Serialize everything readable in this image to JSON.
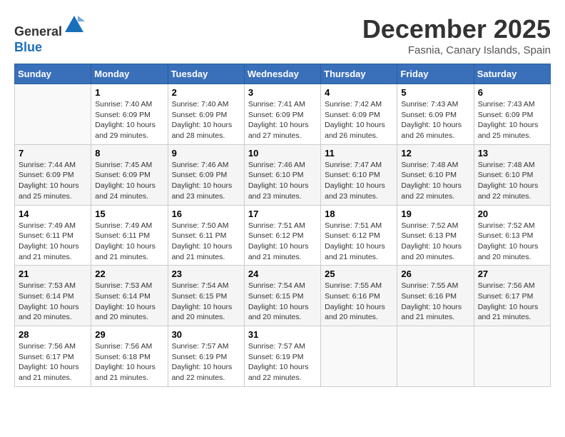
{
  "header": {
    "logo_line1": "General",
    "logo_line2": "Blue",
    "month": "December 2025",
    "location": "Fasnia, Canary Islands, Spain"
  },
  "days_of_week": [
    "Sunday",
    "Monday",
    "Tuesday",
    "Wednesday",
    "Thursday",
    "Friday",
    "Saturday"
  ],
  "weeks": [
    [
      {
        "day": "",
        "text": ""
      },
      {
        "day": "1",
        "text": "Sunrise: 7:40 AM\nSunset: 6:09 PM\nDaylight: 10 hours and 29 minutes."
      },
      {
        "day": "2",
        "text": "Sunrise: 7:40 AM\nSunset: 6:09 PM\nDaylight: 10 hours and 28 minutes."
      },
      {
        "day": "3",
        "text": "Sunrise: 7:41 AM\nSunset: 6:09 PM\nDaylight: 10 hours and 27 minutes."
      },
      {
        "day": "4",
        "text": "Sunrise: 7:42 AM\nSunset: 6:09 PM\nDaylight: 10 hours and 26 minutes."
      },
      {
        "day": "5",
        "text": "Sunrise: 7:43 AM\nSunset: 6:09 PM\nDaylight: 10 hours and 26 minutes."
      },
      {
        "day": "6",
        "text": "Sunrise: 7:43 AM\nSunset: 6:09 PM\nDaylight: 10 hours and 25 minutes."
      }
    ],
    [
      {
        "day": "7",
        "text": "Sunrise: 7:44 AM\nSunset: 6:09 PM\nDaylight: 10 hours and 25 minutes."
      },
      {
        "day": "8",
        "text": "Sunrise: 7:45 AM\nSunset: 6:09 PM\nDaylight: 10 hours and 24 minutes."
      },
      {
        "day": "9",
        "text": "Sunrise: 7:46 AM\nSunset: 6:09 PM\nDaylight: 10 hours and 23 minutes."
      },
      {
        "day": "10",
        "text": "Sunrise: 7:46 AM\nSunset: 6:10 PM\nDaylight: 10 hours and 23 minutes."
      },
      {
        "day": "11",
        "text": "Sunrise: 7:47 AM\nSunset: 6:10 PM\nDaylight: 10 hours and 23 minutes."
      },
      {
        "day": "12",
        "text": "Sunrise: 7:48 AM\nSunset: 6:10 PM\nDaylight: 10 hours and 22 minutes."
      },
      {
        "day": "13",
        "text": "Sunrise: 7:48 AM\nSunset: 6:10 PM\nDaylight: 10 hours and 22 minutes."
      }
    ],
    [
      {
        "day": "14",
        "text": "Sunrise: 7:49 AM\nSunset: 6:11 PM\nDaylight: 10 hours and 21 minutes."
      },
      {
        "day": "15",
        "text": "Sunrise: 7:49 AM\nSunset: 6:11 PM\nDaylight: 10 hours and 21 minutes."
      },
      {
        "day": "16",
        "text": "Sunrise: 7:50 AM\nSunset: 6:11 PM\nDaylight: 10 hours and 21 minutes."
      },
      {
        "day": "17",
        "text": "Sunrise: 7:51 AM\nSunset: 6:12 PM\nDaylight: 10 hours and 21 minutes."
      },
      {
        "day": "18",
        "text": "Sunrise: 7:51 AM\nSunset: 6:12 PM\nDaylight: 10 hours and 21 minutes."
      },
      {
        "day": "19",
        "text": "Sunrise: 7:52 AM\nSunset: 6:13 PM\nDaylight: 10 hours and 20 minutes."
      },
      {
        "day": "20",
        "text": "Sunrise: 7:52 AM\nSunset: 6:13 PM\nDaylight: 10 hours and 20 minutes."
      }
    ],
    [
      {
        "day": "21",
        "text": "Sunrise: 7:53 AM\nSunset: 6:14 PM\nDaylight: 10 hours and 20 minutes."
      },
      {
        "day": "22",
        "text": "Sunrise: 7:53 AM\nSunset: 6:14 PM\nDaylight: 10 hours and 20 minutes."
      },
      {
        "day": "23",
        "text": "Sunrise: 7:54 AM\nSunset: 6:15 PM\nDaylight: 10 hours and 20 minutes."
      },
      {
        "day": "24",
        "text": "Sunrise: 7:54 AM\nSunset: 6:15 PM\nDaylight: 10 hours and 20 minutes."
      },
      {
        "day": "25",
        "text": "Sunrise: 7:55 AM\nSunset: 6:16 PM\nDaylight: 10 hours and 20 minutes."
      },
      {
        "day": "26",
        "text": "Sunrise: 7:55 AM\nSunset: 6:16 PM\nDaylight: 10 hours and 21 minutes."
      },
      {
        "day": "27",
        "text": "Sunrise: 7:56 AM\nSunset: 6:17 PM\nDaylight: 10 hours and 21 minutes."
      }
    ],
    [
      {
        "day": "28",
        "text": "Sunrise: 7:56 AM\nSunset: 6:17 PM\nDaylight: 10 hours and 21 minutes."
      },
      {
        "day": "29",
        "text": "Sunrise: 7:56 AM\nSunset: 6:18 PM\nDaylight: 10 hours and 21 minutes."
      },
      {
        "day": "30",
        "text": "Sunrise: 7:57 AM\nSunset: 6:19 PM\nDaylight: 10 hours and 22 minutes."
      },
      {
        "day": "31",
        "text": "Sunrise: 7:57 AM\nSunset: 6:19 PM\nDaylight: 10 hours and 22 minutes."
      },
      {
        "day": "",
        "text": ""
      },
      {
        "day": "",
        "text": ""
      },
      {
        "day": "",
        "text": ""
      }
    ]
  ]
}
